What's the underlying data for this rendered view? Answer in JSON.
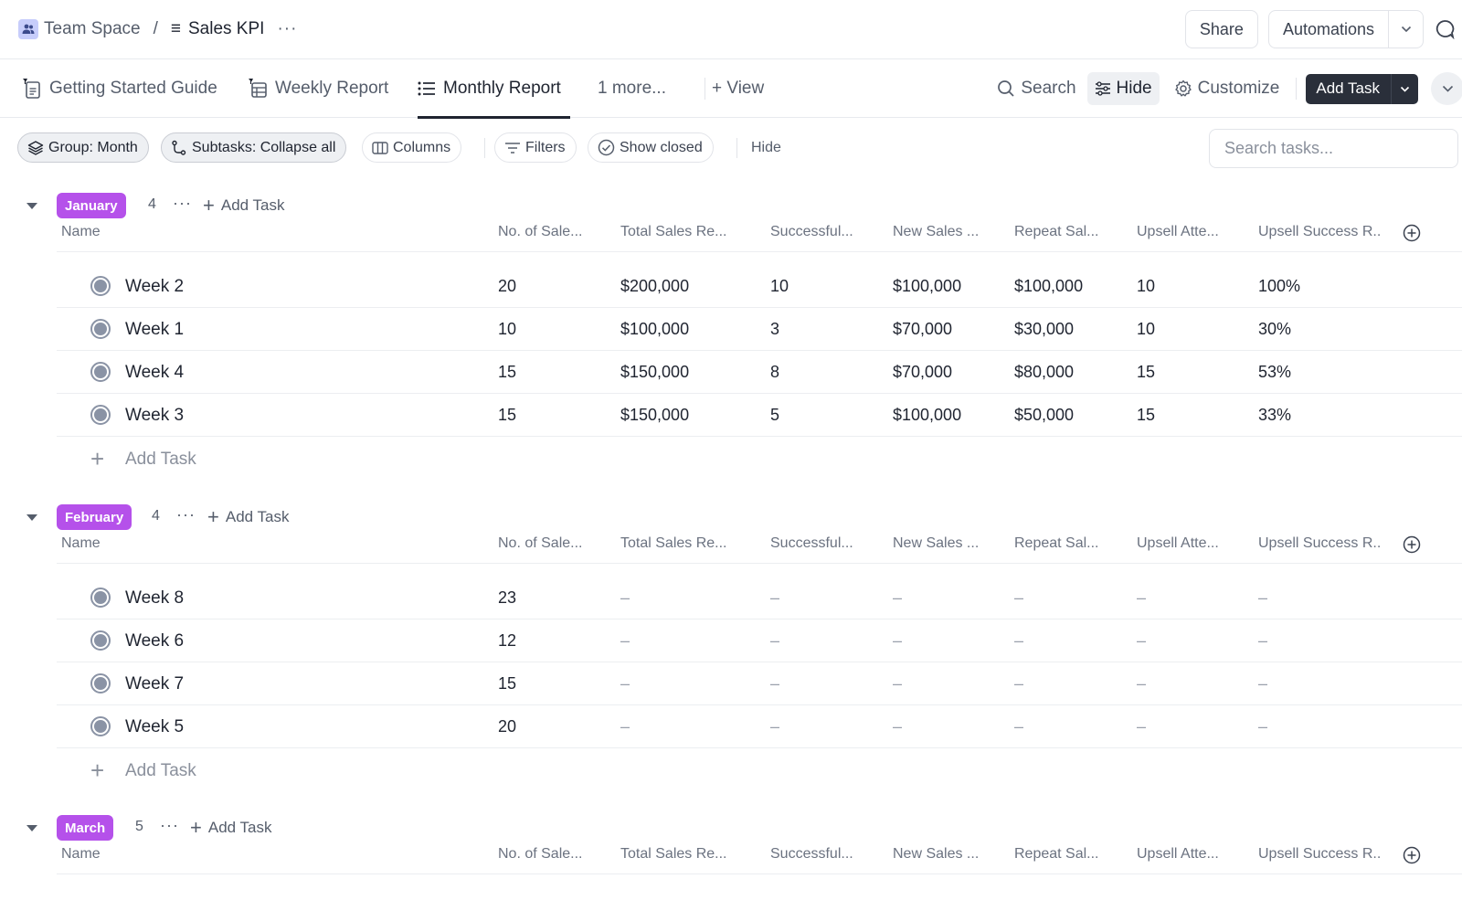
{
  "breadcrumb": {
    "space": "Team Space",
    "separator": "/",
    "title": "Sales KPI",
    "more": "···"
  },
  "header": {
    "share_label": "Share",
    "automations_label": "Automations"
  },
  "views": {
    "tabs": [
      {
        "label": "Getting Started Guide",
        "icon": "pinned-doc-icon",
        "active": false
      },
      {
        "label": "Weekly Report",
        "icon": "pinned-table-icon",
        "active": false
      },
      {
        "label": "Monthly Report",
        "icon": "list-icon",
        "active": true
      }
    ],
    "more_label": "1 more...",
    "add_view_label": "+ View",
    "search_label": "Search",
    "hide_label": "Hide",
    "customize_label": "Customize",
    "add_task_label": "Add Task"
  },
  "filters": {
    "group_label": "Group: Month",
    "subtasks_label": "Subtasks: Collapse all",
    "columns_label": "Columns",
    "filters_label": "Filters",
    "show_closed_label": "Show closed",
    "hide_label": "Hide",
    "search_placeholder": "Search tasks..."
  },
  "columns": [
    "Name",
    "No. of Sale...",
    "Total Sales Re...",
    "Successful...",
    "New Sales ...",
    "Repeat Sal...",
    "Upsell Atte...",
    "Upsell Success R.."
  ],
  "add_task_label": "Add Task",
  "group_add_label": "Add Task",
  "group_more": "···",
  "groups": [
    {
      "name": "January",
      "count": "4",
      "color": "#b551ea",
      "rows": [
        {
          "name": "Week 2",
          "cells": [
            "20",
            "$200,000",
            "10",
            "$100,000",
            "$100,000",
            "10",
            "100%"
          ]
        },
        {
          "name": "Week 1",
          "cells": [
            "10",
            "$100,000",
            "3",
            "$70,000",
            "$30,000",
            "10",
            "30%"
          ]
        },
        {
          "name": "Week 4",
          "cells": [
            "15",
            "$150,000",
            "8",
            "$70,000",
            "$80,000",
            "15",
            "53%"
          ]
        },
        {
          "name": "Week 3",
          "cells": [
            "15",
            "$150,000",
            "5",
            "$100,000",
            "$50,000",
            "15",
            "33%"
          ]
        }
      ]
    },
    {
      "name": "February",
      "count": "4",
      "color": "#b551ea",
      "rows": [
        {
          "name": "Week 8",
          "cells": [
            "23",
            "–",
            "–",
            "–",
            "–",
            "–",
            "–"
          ]
        },
        {
          "name": "Week 6",
          "cells": [
            "12",
            "–",
            "–",
            "–",
            "–",
            "–",
            "–"
          ]
        },
        {
          "name": "Week 7",
          "cells": [
            "15",
            "–",
            "–",
            "–",
            "–",
            "–",
            "–"
          ]
        },
        {
          "name": "Week 5",
          "cells": [
            "20",
            "–",
            "–",
            "–",
            "–",
            "–",
            "–"
          ]
        }
      ]
    },
    {
      "name": "March",
      "count": "5",
      "color": "#b551ea",
      "rows": []
    }
  ]
}
